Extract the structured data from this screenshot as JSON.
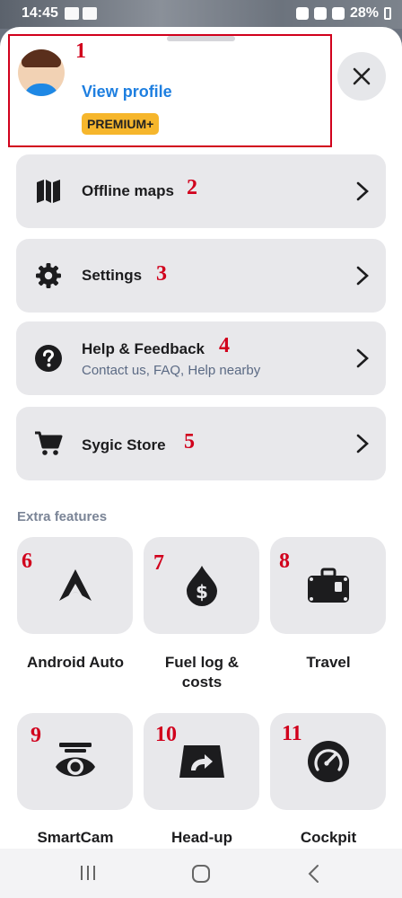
{
  "status_bar": {
    "time": "14:45",
    "battery": "28%"
  },
  "profile": {
    "view_profile": "View profile",
    "badge": "PREMIUM+"
  },
  "menu": [
    {
      "label": "Offline maps",
      "icon": "map-icon"
    },
    {
      "label": "Settings",
      "icon": "gear-icon"
    },
    {
      "label": "Help & Feedback",
      "sub": "Contact us, FAQ, Help nearby",
      "icon": "help-icon"
    },
    {
      "label": "Sygic Store",
      "icon": "cart-icon"
    }
  ],
  "extra_features": {
    "title": "Extra features",
    "tiles": [
      {
        "line1": "Android Auto",
        "line2": "",
        "icon": "android-auto-icon"
      },
      {
        "line1": "Fuel log &",
        "line2": "costs",
        "icon": "fuel-drop-icon"
      },
      {
        "line1": "Travel",
        "line2": "",
        "icon": "suitcase-icon"
      },
      {
        "line1": "SmartCam",
        "line2": "",
        "icon": "smartcam-icon"
      },
      {
        "line1": "Head-up",
        "line2": "",
        "icon": "head-up-icon"
      },
      {
        "line1": "Cockpit",
        "line2": "",
        "icon": "cockpit-gauge-icon"
      }
    ]
  },
  "annotations": [
    "1",
    "2",
    "3",
    "4",
    "5",
    "6",
    "7",
    "8",
    "9",
    "10",
    "11"
  ],
  "colors": {
    "accent": "#1e7fe0",
    "badge": "#f6b62c",
    "annotation": "#d1001c",
    "card": "#e8e8eb"
  }
}
